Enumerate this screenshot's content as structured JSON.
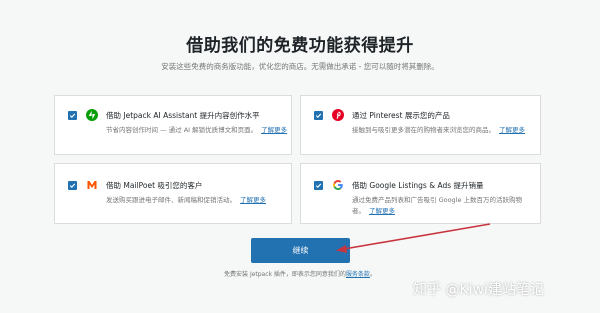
{
  "header": {
    "title": "借助我们的免费功能获得提升",
    "subtitle": "安装这些免费的商务版功能，优化您的商店。无需做出承诺 - 您可以随时将其删除。"
  },
  "features": [
    {
      "title": "借助 Jetpack AI Assistant 提升内容创作水平",
      "desc": "节省内容创作时间 — 通过 AI 解锁优质博文和页面。",
      "link": "了解更多",
      "icon": "jetpack-bolt-icon",
      "checked": true
    },
    {
      "title": "通过 Pinterest 展示您的产品",
      "desc": "接触到与吸引更多潜在的购物者来浏览您的商品。",
      "link": "了解更多",
      "icon": "pinterest-icon",
      "checked": true
    },
    {
      "title": "借助 MailPoet 吸引您的客户",
      "desc": "发送购买跟进电子邮件、新闻稿和促销活动。",
      "link": "了解更多",
      "icon": "mailpoet-icon",
      "checked": true
    },
    {
      "title": "借助 Google Listings & Ads 提升销量",
      "desc_lines": [
        "通过免费产品列表和广告吸引 Google 上数百万的活跃购物",
        "者。"
      ],
      "link": "了解更多",
      "icon": "google-g-icon",
      "checked": true
    }
  ],
  "actions": {
    "continue_label": "继续"
  },
  "footer": {
    "tos_text": "免费安装 Jetpack 插件，即表示您同意我们的",
    "tos_link": "服务条款",
    "tos_end": "。"
  },
  "watermark": "知乎 @Kiwi建站笔记",
  "colors": {
    "primary": "#2271b1",
    "jetpack": "#069e08",
    "pinterest": "#e60023",
    "mailpoet": "#fe5301",
    "annotation_arrow": "#c9353f"
  }
}
